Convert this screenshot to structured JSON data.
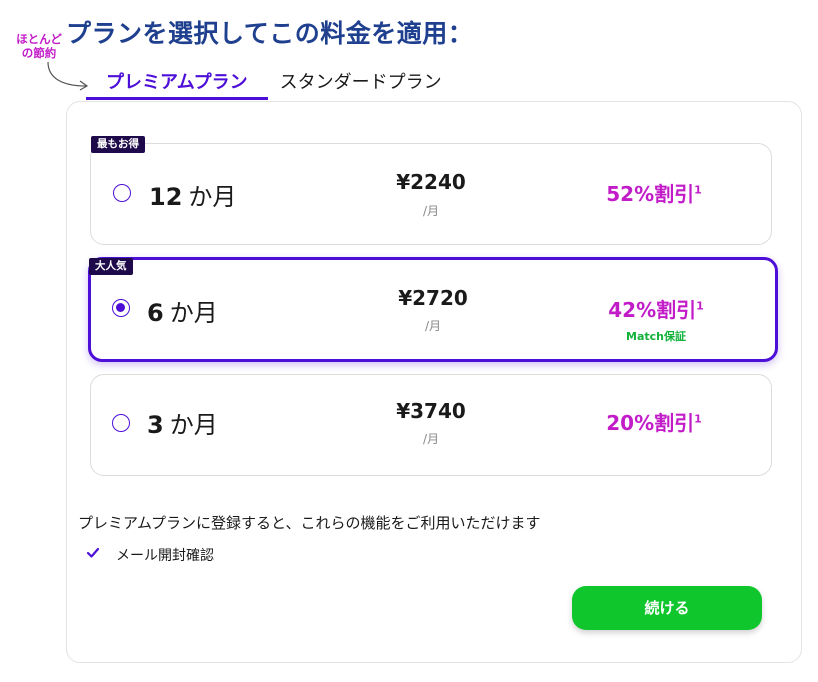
{
  "page": {
    "title": "プランを選択してこの料金を適用：",
    "savings_note": "ほとんどの節約"
  },
  "tabs": [
    {
      "label": "プレミアムプラン",
      "active": true
    },
    {
      "label": "スタンダードプラン",
      "active": false
    }
  ],
  "plans": [
    {
      "badge": "最もお得",
      "months": "12",
      "unit": "か月",
      "price": "¥2240",
      "per": "/月",
      "discount": "52%割引",
      "footnote": "1",
      "guarantee": "",
      "selected": false
    },
    {
      "badge": "大人気",
      "months": "6",
      "unit": "か月",
      "price": "¥2720",
      "per": "/月",
      "discount": "42%割引",
      "footnote": "1",
      "guarantee": "Match保証",
      "selected": true
    },
    {
      "badge": "",
      "months": "3",
      "unit": "か月",
      "price": "¥3740",
      "per": "/月",
      "discount": "20%割引",
      "footnote": "1",
      "guarantee": "",
      "selected": false
    }
  ],
  "features": {
    "heading": "プレミアムプランに登録すると、これらの機能をご利用いただけます",
    "items": [
      {
        "label": "メール開封確認",
        "icon": "check-icon"
      }
    ]
  },
  "continue_button": {
    "label": "続ける"
  },
  "colors": {
    "title": "#1f3f8f",
    "accent": "#4d0fd8",
    "discount": "#c21cc9",
    "guarantee": "#12b23a",
    "button": "#0fc62c",
    "badge_bg": "#1e0a4a"
  }
}
